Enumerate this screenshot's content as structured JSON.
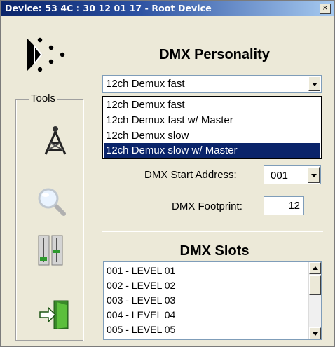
{
  "window": {
    "title": "Device: 53 4C : 30 12 01 17 - Root Device",
    "close_glyph": "×"
  },
  "tools": {
    "legend": "Tools",
    "items": [
      {
        "icon": "antenna-tower-icon"
      },
      {
        "icon": "magnifier-icon"
      },
      {
        "icon": "fader-sliders-icon"
      },
      {
        "icon": "exit-door-icon"
      }
    ]
  },
  "personality": {
    "heading": "DMX Personality",
    "selected": "12ch Demux fast",
    "options": [
      "12ch Demux fast",
      "12ch Demux fast w/ Master",
      "12ch Demux slow",
      "12ch Demux slow w/ Master"
    ],
    "highlighted_index": 3
  },
  "start_address": {
    "label": "DMX Start Address:",
    "value": "001"
  },
  "footprint": {
    "label": "DMX Footprint:",
    "value": "12"
  },
  "slots": {
    "heading": "DMX Slots",
    "items": [
      "001 - LEVEL 01",
      "002 - LEVEL 02",
      "003 - LEVEL 03",
      "004 - LEVEL 04",
      "005 - LEVEL 05"
    ]
  },
  "colors": {
    "titlebar_start": "#0a246a",
    "titlebar_end": "#a6caf0",
    "selection": "#0a246a",
    "face": "#ece9d8"
  }
}
